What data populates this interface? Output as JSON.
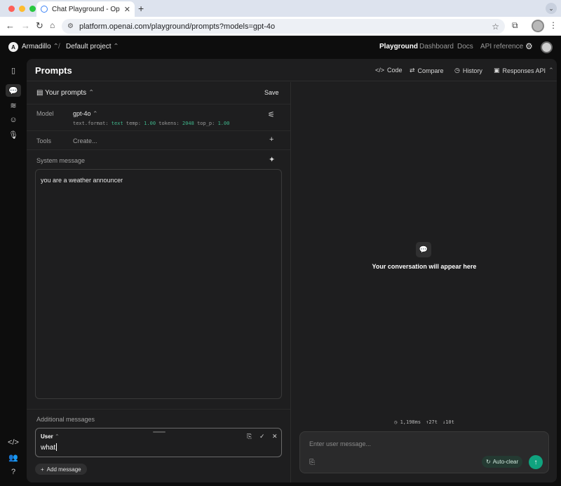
{
  "browser": {
    "tab_title": "Chat Playground - OpenAI API",
    "tab_close": "✕",
    "new_tab": "+",
    "url": "platform.openai.com/playground/prompts?models=gpt-4o",
    "traffic_colors": [
      "#ff5f57",
      "#febc2e",
      "#28c840"
    ]
  },
  "header": {
    "workspace_initial": "A",
    "workspace": "Armadillo",
    "separator": "/",
    "project": "Default project",
    "nav": [
      {
        "label": "Playground",
        "active": true
      },
      {
        "label": "Dashboard",
        "active": false
      },
      {
        "label": "Docs",
        "active": false
      },
      {
        "label": "API reference",
        "active": false
      }
    ]
  },
  "page": {
    "title": "Prompts",
    "actions": {
      "code": "Code",
      "compare": "Compare",
      "history": "History",
      "api": "Responses API"
    }
  },
  "prompt_panel": {
    "your_prompts": "Your prompts",
    "save": "Save",
    "model_label": "Model",
    "model": "gpt-4o",
    "params": {
      "format_key": "text.format:",
      "format_val": "text",
      "temp_key": "temp:",
      "temp_val": "1.00",
      "tokens_key": "tokens:",
      "tokens_val": "2048",
      "top_p_key": "top_p:",
      "top_p_val": "1.00"
    },
    "tools_label": "Tools",
    "tools_value": "Create...",
    "system_label": "System message",
    "system_message": "you are a weather announcer",
    "additional_label": "Additional messages",
    "message": {
      "role": "User",
      "text": "what"
    },
    "add_message": "Add message"
  },
  "conversation": {
    "empty_text": "Your conversation will appear here",
    "stats": {
      "latency": "1,198ms",
      "tokens_in": "27t",
      "tokens_out": "10t"
    },
    "composer_placeholder": "Enter user message...",
    "auto_clear": "Auto-clear"
  },
  "colors": {
    "accent_green": "#10a37f",
    "param_value": "#3fb68b"
  }
}
